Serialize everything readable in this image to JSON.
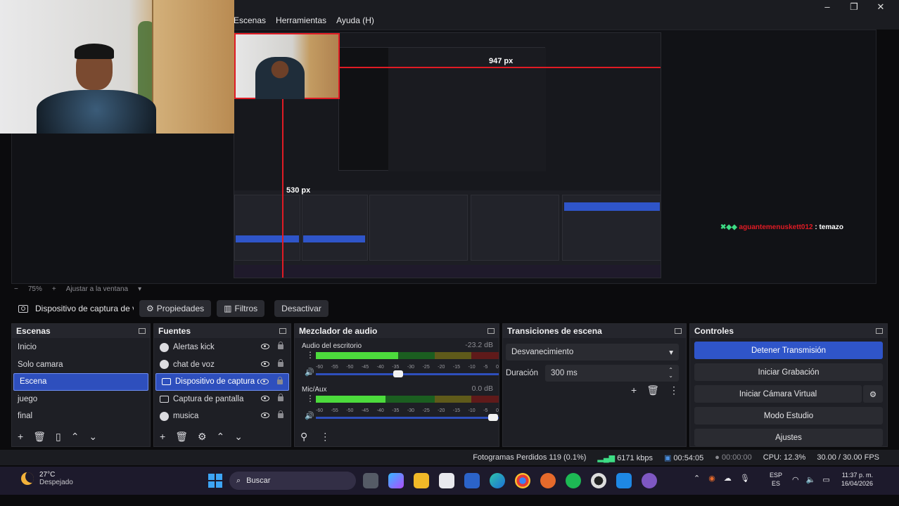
{
  "menu": [
    "Escenas",
    "Herramientas",
    "Ayuda (H)"
  ],
  "window_controls": {
    "minimize": "–",
    "maximize": "❐",
    "close": "✕"
  },
  "preview": {
    "measure_top": "947 px",
    "measure_left": "530 px",
    "chat_user": "aguantemenuskett012",
    "chat_msg": ": temazo"
  },
  "zoombar": {
    "minus": "−",
    "zoom": "75%",
    "plus": "+",
    "fit": "Ajustar a la ventana",
    "caret": "▾"
  },
  "source_toolbar": {
    "source_name": "Dispositivo de captura de v",
    "properties": "Propiedades",
    "filters": "Filtros",
    "deactivate": "Desactivar"
  },
  "scenes": {
    "title": "Escenas",
    "items": [
      "Inicio",
      "Solo camara",
      "Escena",
      "juego",
      "final"
    ],
    "selected_index": 2
  },
  "sources": {
    "title": "Fuentes",
    "items": [
      {
        "label": "Alertas kick",
        "icon": "browser-icon"
      },
      {
        "label": "chat de voz",
        "icon": "browser-icon"
      },
      {
        "label": "Dispositivo de captura de",
        "icon": "camera-icon"
      },
      {
        "label": "Captura de pantalla",
        "icon": "monitor-icon"
      },
      {
        "label": "musica",
        "icon": "browser-icon"
      }
    ],
    "selected_index": 2
  },
  "mixer": {
    "title": "Mezclador de audio",
    "tracks": [
      {
        "name": "Audio del escritorio",
        "db": "-23.2 dB",
        "level": 0.45,
        "volume": 0.45
      },
      {
        "name": "Mic/Aux",
        "db": "0.0 dB",
        "level": 0.38,
        "volume": 0.97
      }
    ],
    "ticks": [
      "-60",
      "-55",
      "-50",
      "-45",
      "-40",
      "-35",
      "-30",
      "-25",
      "-20",
      "-15",
      "-10",
      "-5",
      "0"
    ]
  },
  "transitions": {
    "title": "Transiciones de escena",
    "selected": "Desvanecimiento",
    "duration_label": "Duración",
    "duration_value": "300 ms"
  },
  "controls": {
    "title": "Controles",
    "stop_stream": "Detener Transmisión",
    "start_recording": "Iniciar Grabación",
    "start_virtual_cam": "Iniciar Cámara Virtual",
    "studio_mode": "Modo Estudio",
    "settings": "Ajustes"
  },
  "status": {
    "dropped_frames": "Fotogramas Perdidos 119 (0.1%)",
    "bitrate": "6171 kbps",
    "stream_time": "00:54:05",
    "rec_time": "00:00:00",
    "cpu": "CPU: 12.3%",
    "fps": "30.00 / 30.00 FPS"
  },
  "taskbar": {
    "temp": "27°C",
    "weather": "Despejado",
    "search": "Buscar",
    "lang_top": "ESP",
    "lang_bottom": "ES",
    "time": "11:37 p. m.",
    "date": "16/04/2026"
  },
  "colors": {
    "accent": "#2f55c9",
    "guide_red": "#e01b24",
    "panel": "#1e1f25"
  }
}
